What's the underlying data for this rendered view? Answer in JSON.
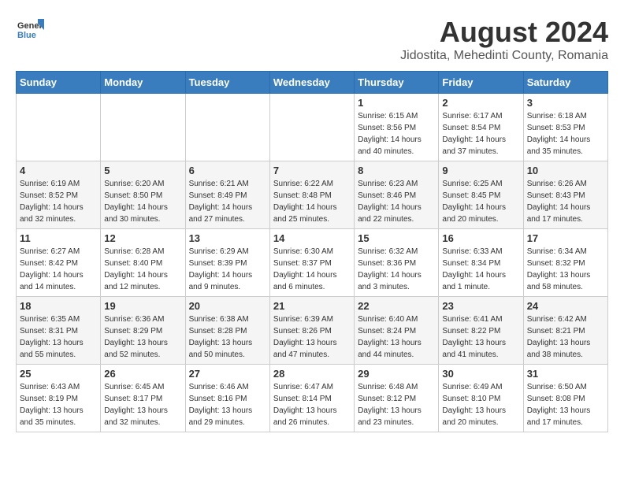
{
  "logo": {
    "general": "General",
    "blue": "Blue"
  },
  "title": {
    "month_year": "August 2024",
    "location": "Jidostita, Mehedinti County, Romania"
  },
  "header": {
    "days": [
      "Sunday",
      "Monday",
      "Tuesday",
      "Wednesday",
      "Thursday",
      "Friday",
      "Saturday"
    ]
  },
  "weeks": [
    [
      {
        "day": "",
        "info": ""
      },
      {
        "day": "",
        "info": ""
      },
      {
        "day": "",
        "info": ""
      },
      {
        "day": "",
        "info": ""
      },
      {
        "day": "1",
        "info": "Sunrise: 6:15 AM\nSunset: 8:56 PM\nDaylight: 14 hours\nand 40 minutes."
      },
      {
        "day": "2",
        "info": "Sunrise: 6:17 AM\nSunset: 8:54 PM\nDaylight: 14 hours\nand 37 minutes."
      },
      {
        "day": "3",
        "info": "Sunrise: 6:18 AM\nSunset: 8:53 PM\nDaylight: 14 hours\nand 35 minutes."
      }
    ],
    [
      {
        "day": "4",
        "info": "Sunrise: 6:19 AM\nSunset: 8:52 PM\nDaylight: 14 hours\nand 32 minutes."
      },
      {
        "day": "5",
        "info": "Sunrise: 6:20 AM\nSunset: 8:50 PM\nDaylight: 14 hours\nand 30 minutes."
      },
      {
        "day": "6",
        "info": "Sunrise: 6:21 AM\nSunset: 8:49 PM\nDaylight: 14 hours\nand 27 minutes."
      },
      {
        "day": "7",
        "info": "Sunrise: 6:22 AM\nSunset: 8:48 PM\nDaylight: 14 hours\nand 25 minutes."
      },
      {
        "day": "8",
        "info": "Sunrise: 6:23 AM\nSunset: 8:46 PM\nDaylight: 14 hours\nand 22 minutes."
      },
      {
        "day": "9",
        "info": "Sunrise: 6:25 AM\nSunset: 8:45 PM\nDaylight: 14 hours\nand 20 minutes."
      },
      {
        "day": "10",
        "info": "Sunrise: 6:26 AM\nSunset: 8:43 PM\nDaylight: 14 hours\nand 17 minutes."
      }
    ],
    [
      {
        "day": "11",
        "info": "Sunrise: 6:27 AM\nSunset: 8:42 PM\nDaylight: 14 hours\nand 14 minutes."
      },
      {
        "day": "12",
        "info": "Sunrise: 6:28 AM\nSunset: 8:40 PM\nDaylight: 14 hours\nand 12 minutes."
      },
      {
        "day": "13",
        "info": "Sunrise: 6:29 AM\nSunset: 8:39 PM\nDaylight: 14 hours\nand 9 minutes."
      },
      {
        "day": "14",
        "info": "Sunrise: 6:30 AM\nSunset: 8:37 PM\nDaylight: 14 hours\nand 6 minutes."
      },
      {
        "day": "15",
        "info": "Sunrise: 6:32 AM\nSunset: 8:36 PM\nDaylight: 14 hours\nand 3 minutes."
      },
      {
        "day": "16",
        "info": "Sunrise: 6:33 AM\nSunset: 8:34 PM\nDaylight: 14 hours\nand 1 minute."
      },
      {
        "day": "17",
        "info": "Sunrise: 6:34 AM\nSunset: 8:32 PM\nDaylight: 13 hours\nand 58 minutes."
      }
    ],
    [
      {
        "day": "18",
        "info": "Sunrise: 6:35 AM\nSunset: 8:31 PM\nDaylight: 13 hours\nand 55 minutes."
      },
      {
        "day": "19",
        "info": "Sunrise: 6:36 AM\nSunset: 8:29 PM\nDaylight: 13 hours\nand 52 minutes."
      },
      {
        "day": "20",
        "info": "Sunrise: 6:38 AM\nSunset: 8:28 PM\nDaylight: 13 hours\nand 50 minutes."
      },
      {
        "day": "21",
        "info": "Sunrise: 6:39 AM\nSunset: 8:26 PM\nDaylight: 13 hours\nand 47 minutes."
      },
      {
        "day": "22",
        "info": "Sunrise: 6:40 AM\nSunset: 8:24 PM\nDaylight: 13 hours\nand 44 minutes."
      },
      {
        "day": "23",
        "info": "Sunrise: 6:41 AM\nSunset: 8:22 PM\nDaylight: 13 hours\nand 41 minutes."
      },
      {
        "day": "24",
        "info": "Sunrise: 6:42 AM\nSunset: 8:21 PM\nDaylight: 13 hours\nand 38 minutes."
      }
    ],
    [
      {
        "day": "25",
        "info": "Sunrise: 6:43 AM\nSunset: 8:19 PM\nDaylight: 13 hours\nand 35 minutes."
      },
      {
        "day": "26",
        "info": "Sunrise: 6:45 AM\nSunset: 8:17 PM\nDaylight: 13 hours\nand 32 minutes."
      },
      {
        "day": "27",
        "info": "Sunrise: 6:46 AM\nSunset: 8:16 PM\nDaylight: 13 hours\nand 29 minutes."
      },
      {
        "day": "28",
        "info": "Sunrise: 6:47 AM\nSunset: 8:14 PM\nDaylight: 13 hours\nand 26 minutes."
      },
      {
        "day": "29",
        "info": "Sunrise: 6:48 AM\nSunset: 8:12 PM\nDaylight: 13 hours\nand 23 minutes."
      },
      {
        "day": "30",
        "info": "Sunrise: 6:49 AM\nSunset: 8:10 PM\nDaylight: 13 hours\nand 20 minutes."
      },
      {
        "day": "31",
        "info": "Sunrise: 6:50 AM\nSunset: 8:08 PM\nDaylight: 13 hours\nand 17 minutes."
      }
    ]
  ]
}
